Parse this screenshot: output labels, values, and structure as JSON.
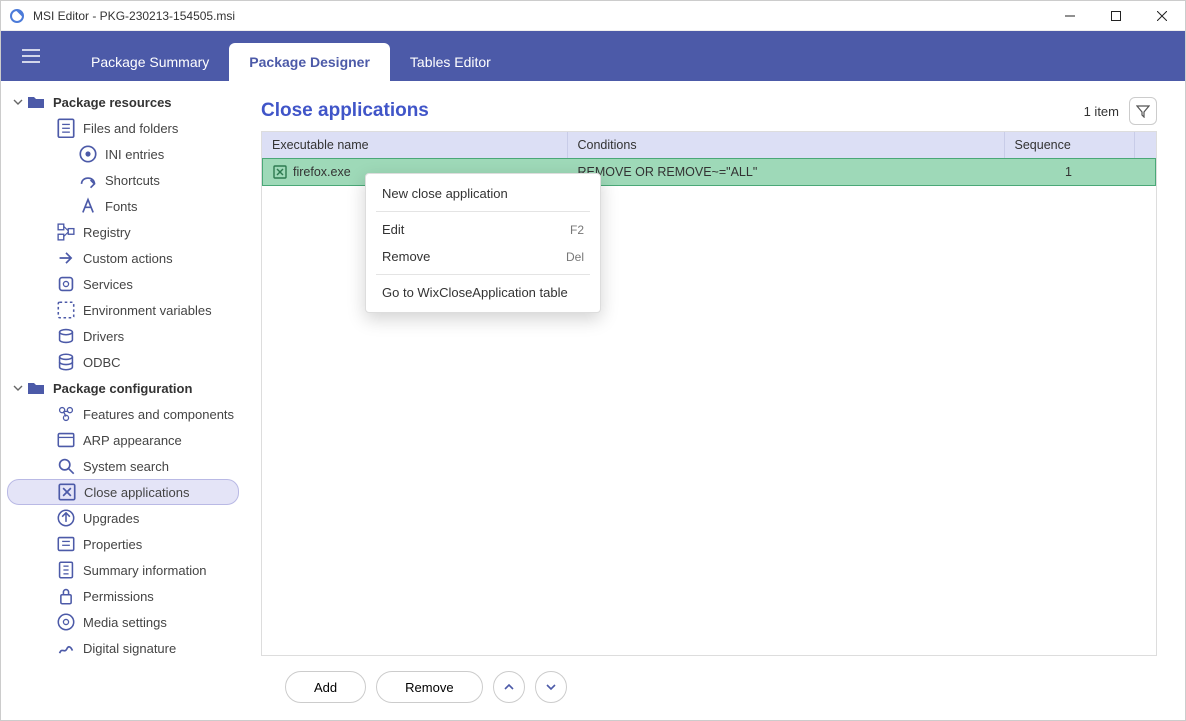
{
  "window": {
    "title": "MSI Editor - PKG-230213-154505.msi"
  },
  "ribbon": {
    "tabs": [
      {
        "label": "Package Summary",
        "active": false
      },
      {
        "label": "Package Designer",
        "active": true
      },
      {
        "label": "Tables Editor",
        "active": false
      }
    ]
  },
  "sidebar": {
    "section1": {
      "label": "Package resources"
    },
    "items1": [
      {
        "label": "Files and folders",
        "icon": "doc"
      },
      {
        "label": "INI entries",
        "icon": "ini",
        "indent": true
      },
      {
        "label": "Shortcuts",
        "icon": "shortcut",
        "indent": true
      },
      {
        "label": "Fonts",
        "icon": "font",
        "indent": true
      },
      {
        "label": "Registry",
        "icon": "registry"
      },
      {
        "label": "Custom actions",
        "icon": "action"
      },
      {
        "label": "Services",
        "icon": "services"
      },
      {
        "label": "Environment variables",
        "icon": "env"
      },
      {
        "label": "Drivers",
        "icon": "driver"
      },
      {
        "label": "ODBC",
        "icon": "odbc"
      }
    ],
    "section2": {
      "label": "Package configuration"
    },
    "items2": [
      {
        "label": "Features and components",
        "icon": "features"
      },
      {
        "label": "ARP appearance",
        "icon": "arp"
      },
      {
        "label": "System search",
        "icon": "search"
      },
      {
        "label": "Close applications",
        "icon": "close",
        "selected": true
      },
      {
        "label": "Upgrades",
        "icon": "upgrade"
      },
      {
        "label": "Properties",
        "icon": "props"
      },
      {
        "label": "Summary information",
        "icon": "summary"
      },
      {
        "label": "Permissions",
        "icon": "perm"
      },
      {
        "label": "Media settings",
        "icon": "media"
      },
      {
        "label": "Digital signature",
        "icon": "sign"
      }
    ]
  },
  "content": {
    "title": "Close applications",
    "item_count": "1 item",
    "columns": {
      "exe": "Executable name",
      "cond": "Conditions",
      "seq": "Sequence"
    },
    "rows": [
      {
        "exe": "firefox.exe",
        "cond": "REMOVE OR REMOVE~=\"ALL\"",
        "seq": "1"
      }
    ]
  },
  "context_menu": {
    "new": "New close application",
    "edit": "Edit",
    "edit_shortcut": "F2",
    "remove": "Remove",
    "remove_shortcut": "Del",
    "goto": "Go to WixCloseApplication table"
  },
  "buttons": {
    "add": "Add",
    "remove": "Remove"
  }
}
